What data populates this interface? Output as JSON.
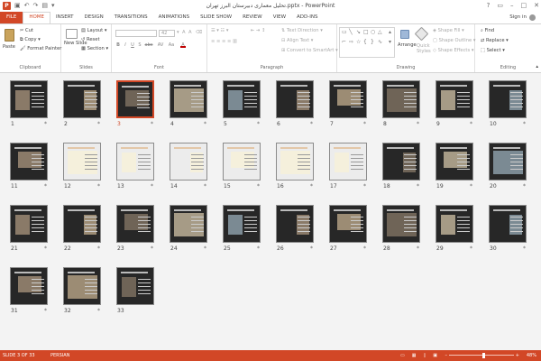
{
  "title_bar": {
    "title": "تحلیل معماری دبیرستان البرز تهران.pptx - PowerPoint",
    "controls": [
      "?",
      "▭",
      "–",
      "□",
      "✕"
    ]
  },
  "tabs": [
    "FILE",
    "HOME",
    "INSERT",
    "DESIGN",
    "TRANSITIONS",
    "ANIMATIONS",
    "SLIDE SHOW",
    "REVIEW",
    "VIEW",
    "ADD-INS"
  ],
  "sign_in": "Sign in",
  "ribbon": {
    "clipboard": {
      "label": "Clipboard",
      "paste": "Paste",
      "cut": "Cut",
      "copy": "Copy",
      "format_painter": "Format Painter"
    },
    "slides": {
      "label": "Slides",
      "new_slide": "New Slide",
      "layout": "Layout",
      "reset": "Reset",
      "section": "Section"
    },
    "font": {
      "label": "Font",
      "size": "42",
      "buttons": [
        "B",
        "I",
        "U",
        "S",
        "abc",
        "AV",
        "Aa",
        "A"
      ]
    },
    "paragraph": {
      "label": "Paragraph",
      "text_direction": "Text Direction",
      "align_text": "Align Text",
      "convert_smartart": "Convert to SmartArt"
    },
    "drawing": {
      "label": "Drawing",
      "arrange": "Arrange",
      "quick_styles": "Quick Styles",
      "shape_fill": "Shape Fill",
      "shape_outline": "Shape Outline",
      "shape_effects": "Shape Effects"
    },
    "editing": {
      "label": "Editing",
      "find": "Find",
      "replace": "Replace",
      "select": "Select"
    }
  },
  "slides": {
    "selected": 3,
    "items": [
      {
        "n": "1",
        "star": "*"
      },
      {
        "n": "2",
        "star": "*"
      },
      {
        "n": "3",
        "star": "*"
      },
      {
        "n": "4",
        "star": "*"
      },
      {
        "n": "5",
        "star": "*"
      },
      {
        "n": "6",
        "star": "*"
      },
      {
        "n": "7",
        "star": "*"
      },
      {
        "n": "8",
        "star": "*"
      },
      {
        "n": "9",
        "star": "*"
      },
      {
        "n": "10",
        "star": "*"
      },
      {
        "n": "11",
        "star": "*"
      },
      {
        "n": "12",
        "star": "*"
      },
      {
        "n": "13",
        "star": "*"
      },
      {
        "n": "14",
        "star": "*"
      },
      {
        "n": "15",
        "star": "*"
      },
      {
        "n": "16",
        "star": "*"
      },
      {
        "n": "17",
        "star": "*"
      },
      {
        "n": "18",
        "star": "*"
      },
      {
        "n": "19",
        "star": "*"
      },
      {
        "n": "20",
        "star": "*"
      },
      {
        "n": "21",
        "star": "*"
      },
      {
        "n": "22",
        "star": "*"
      },
      {
        "n": "23",
        "star": "*"
      },
      {
        "n": "24",
        "star": "*"
      },
      {
        "n": "25",
        "star": "*"
      },
      {
        "n": "26",
        "star": "*"
      },
      {
        "n": "27",
        "star": "*"
      },
      {
        "n": "28",
        "star": "*"
      },
      {
        "n": "29",
        "star": "*"
      },
      {
        "n": "30",
        "star": "*"
      },
      {
        "n": "31",
        "star": "*"
      },
      {
        "n": "32",
        "star": "*"
      },
      {
        "n": "33",
        "star": ""
      }
    ]
  },
  "status": {
    "slide_info": "SLIDE 3 OF 33",
    "language": "PERSIAN",
    "zoom_minus": "–",
    "zoom_plus": "+",
    "zoom": "48%",
    "zoom_fraction": 0.48
  },
  "colors": {
    "accent": "#d24726",
    "sorter_bg": "#f3f3f3",
    "slide_bg": "#272727"
  }
}
